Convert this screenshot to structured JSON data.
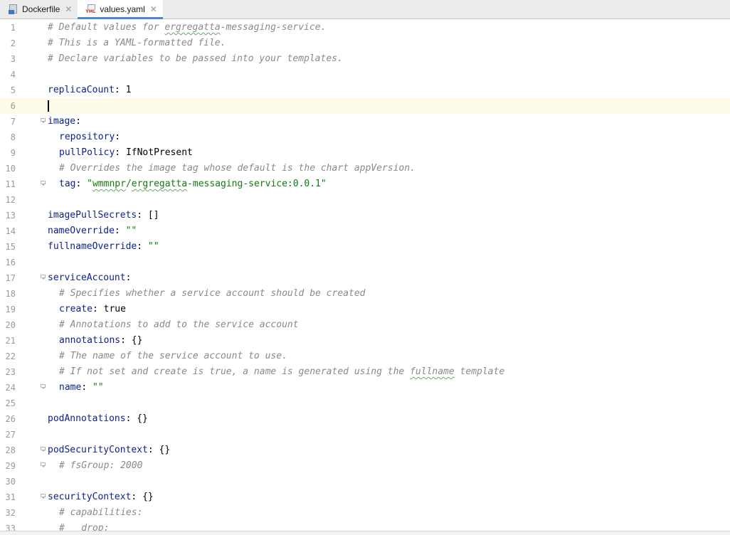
{
  "tabs": [
    {
      "label": "Dockerfile",
      "icon": "dockerfile-icon",
      "active": false
    },
    {
      "label": "values.yaml",
      "icon": "yaml-file-icon",
      "active": true
    }
  ],
  "icon_badges": {
    "yaml": "YML"
  },
  "current_line": 6,
  "lines": [
    {
      "n": "1",
      "indent": 0,
      "fold": false,
      "parts": [
        {
          "t": "c",
          "v": "# Default values for "
        },
        {
          "t": "c sq",
          "v": "ergregatta"
        },
        {
          "t": "c",
          "v": "-messaging-service."
        }
      ]
    },
    {
      "n": "2",
      "indent": 0,
      "fold": false,
      "parts": [
        {
          "t": "c",
          "v": "# This is a YAML-formatted file."
        }
      ]
    },
    {
      "n": "3",
      "indent": 0,
      "fold": false,
      "parts": [
        {
          "t": "c",
          "v": "# Declare variables to be passed into your templates."
        }
      ]
    },
    {
      "n": "4",
      "indent": 0,
      "fold": false,
      "parts": []
    },
    {
      "n": "5",
      "indent": 0,
      "fold": false,
      "parts": [
        {
          "t": "k",
          "v": "replicaCount"
        },
        {
          "t": "p",
          "v": ": "
        },
        {
          "t": "v",
          "v": "1"
        }
      ]
    },
    {
      "n": "6",
      "indent": 0,
      "fold": false,
      "parts": []
    },
    {
      "n": "7",
      "indent": 0,
      "fold": true,
      "parts": [
        {
          "t": "k",
          "v": "image"
        },
        {
          "t": "p",
          "v": ":"
        }
      ]
    },
    {
      "n": "8",
      "indent": 2,
      "fold": false,
      "parts": [
        {
          "t": "k",
          "v": "repository"
        },
        {
          "t": "p",
          "v": ":"
        }
      ]
    },
    {
      "n": "9",
      "indent": 2,
      "fold": false,
      "parts": [
        {
          "t": "k",
          "v": "pullPolicy"
        },
        {
          "t": "p",
          "v": ": "
        },
        {
          "t": "v",
          "v": "IfNotPresent"
        }
      ]
    },
    {
      "n": "10",
      "indent": 2,
      "fold": false,
      "parts": [
        {
          "t": "c",
          "v": "# Overrides the image tag whose default is the chart appVersion."
        }
      ]
    },
    {
      "n": "11",
      "indent": 2,
      "fold": true,
      "parts": [
        {
          "t": "k",
          "v": "tag"
        },
        {
          "t": "p",
          "v": ": "
        },
        {
          "t": "s",
          "v": "\""
        },
        {
          "t": "s sq",
          "v": "wmmnpr"
        },
        {
          "t": "s",
          "v": "/"
        },
        {
          "t": "s sq",
          "v": "ergregatta"
        },
        {
          "t": "s",
          "v": "-messaging-service:0.0.1\""
        }
      ]
    },
    {
      "n": "12",
      "indent": 0,
      "fold": false,
      "parts": []
    },
    {
      "n": "13",
      "indent": 0,
      "fold": false,
      "parts": [
        {
          "t": "k",
          "v": "imagePullSecrets"
        },
        {
          "t": "p",
          "v": ": "
        },
        {
          "t": "v",
          "v": "[]"
        }
      ]
    },
    {
      "n": "14",
      "indent": 0,
      "fold": false,
      "parts": [
        {
          "t": "k",
          "v": "nameOverride"
        },
        {
          "t": "p",
          "v": ": "
        },
        {
          "t": "s",
          "v": "\"\""
        }
      ]
    },
    {
      "n": "15",
      "indent": 0,
      "fold": false,
      "parts": [
        {
          "t": "k",
          "v": "fullnameOverride"
        },
        {
          "t": "p",
          "v": ": "
        },
        {
          "t": "s",
          "v": "\"\""
        }
      ]
    },
    {
      "n": "16",
      "indent": 0,
      "fold": false,
      "parts": []
    },
    {
      "n": "17",
      "indent": 0,
      "fold": true,
      "parts": [
        {
          "t": "k",
          "v": "serviceAccount"
        },
        {
          "t": "p",
          "v": ":"
        }
      ]
    },
    {
      "n": "18",
      "indent": 2,
      "fold": false,
      "parts": [
        {
          "t": "c",
          "v": "# Specifies whether a service account should be created"
        }
      ]
    },
    {
      "n": "19",
      "indent": 2,
      "fold": false,
      "parts": [
        {
          "t": "k",
          "v": "create"
        },
        {
          "t": "p",
          "v": ": "
        },
        {
          "t": "v",
          "v": "true"
        }
      ]
    },
    {
      "n": "20",
      "indent": 2,
      "fold": false,
      "parts": [
        {
          "t": "c",
          "v": "# Annotations to add to the service account"
        }
      ]
    },
    {
      "n": "21",
      "indent": 2,
      "fold": false,
      "parts": [
        {
          "t": "k",
          "v": "annotations"
        },
        {
          "t": "p",
          "v": ": "
        },
        {
          "t": "v",
          "v": "{}"
        }
      ]
    },
    {
      "n": "22",
      "indent": 2,
      "fold": false,
      "parts": [
        {
          "t": "c",
          "v": "# The name of the service account to use."
        }
      ]
    },
    {
      "n": "23",
      "indent": 2,
      "fold": false,
      "parts": [
        {
          "t": "c",
          "v": "# If not set and create is true, a name is generated using the "
        },
        {
          "t": "c sq",
          "v": "fullname"
        },
        {
          "t": "c",
          "v": " template"
        }
      ]
    },
    {
      "n": "24",
      "indent": 2,
      "fold": true,
      "parts": [
        {
          "t": "k",
          "v": "name"
        },
        {
          "t": "p",
          "v": ": "
        },
        {
          "t": "s",
          "v": "\"\""
        }
      ]
    },
    {
      "n": "25",
      "indent": 0,
      "fold": false,
      "parts": []
    },
    {
      "n": "26",
      "indent": 0,
      "fold": false,
      "parts": [
        {
          "t": "k",
          "v": "podAnnotations"
        },
        {
          "t": "p",
          "v": ": "
        },
        {
          "t": "v",
          "v": "{}"
        }
      ]
    },
    {
      "n": "27",
      "indent": 0,
      "fold": false,
      "parts": []
    },
    {
      "n": "28",
      "indent": 0,
      "fold": true,
      "parts": [
        {
          "t": "k",
          "v": "podSecurityContext"
        },
        {
          "t": "p",
          "v": ": "
        },
        {
          "t": "v",
          "v": "{}"
        }
      ]
    },
    {
      "n": "29",
      "indent": 2,
      "fold": true,
      "parts": [
        {
          "t": "c",
          "v": "# fsGroup: 2000"
        }
      ]
    },
    {
      "n": "30",
      "indent": 0,
      "fold": false,
      "parts": []
    },
    {
      "n": "31",
      "indent": 0,
      "fold": true,
      "parts": [
        {
          "t": "k",
          "v": "securityContext"
        },
        {
          "t": "p",
          "v": ": "
        },
        {
          "t": "v",
          "v": "{}"
        }
      ]
    },
    {
      "n": "32",
      "indent": 2,
      "fold": false,
      "parts": [
        {
          "t": "c",
          "v": "# capabilities:"
        }
      ]
    },
    {
      "n": "33",
      "indent": 2,
      "fold": false,
      "parts": [
        {
          "t": "c",
          "v": "#   drop:"
        }
      ]
    }
  ]
}
